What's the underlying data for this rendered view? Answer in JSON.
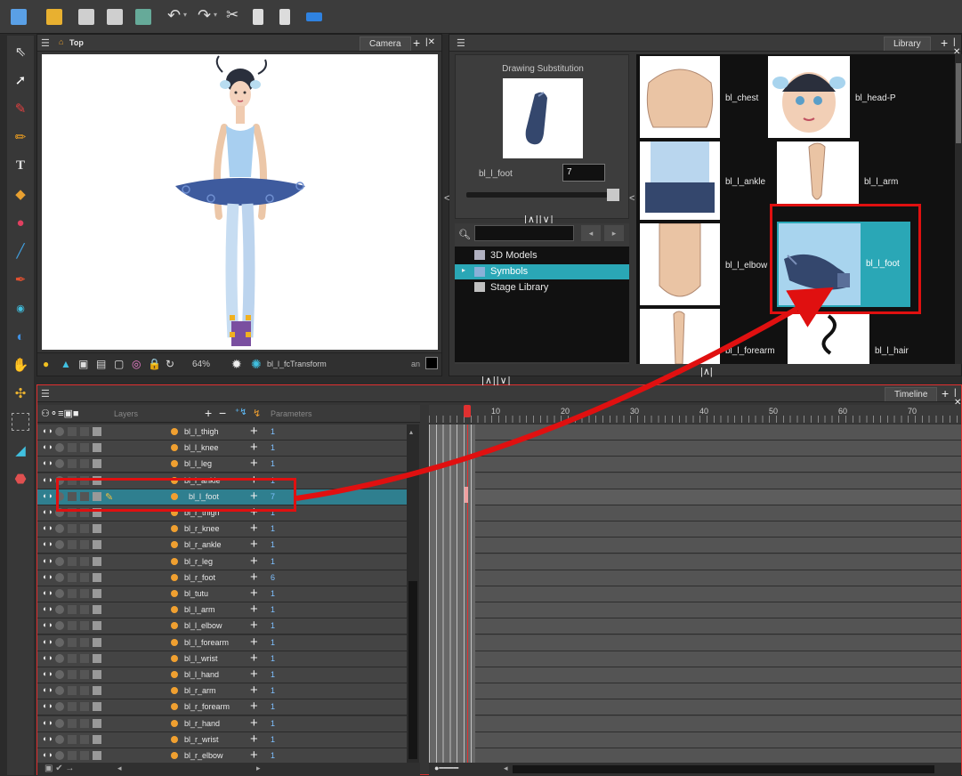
{
  "camera": {
    "title": "Top",
    "tab": "Camera",
    "zoom": "64%",
    "transform_label": "bl_l_fcTransform",
    "right_label": "an"
  },
  "library": {
    "tab": "Library",
    "substitution_title": "Drawing Substitution",
    "element_name": "bl_l_foot",
    "drawing_value": "7",
    "tree": [
      {
        "label": "3D Models"
      },
      {
        "label": "Symbols"
      },
      {
        "label": "Stage Library"
      }
    ],
    "cells": [
      {
        "label": "bl_chest"
      },
      {
        "label": "bl_head-P"
      },
      {
        "label": "bl_l_ankle"
      },
      {
        "label": "bl_l_arm"
      },
      {
        "label": "bl_l_elbow"
      },
      {
        "label": "bl_l_foot"
      },
      {
        "label": "bl_l_forearm"
      },
      {
        "label": "bl_l_hair"
      }
    ]
  },
  "timeline": {
    "tab": "Timeline",
    "col_layers": "Layers",
    "col_parameters": "Parameters",
    "frame_labels": [
      "10",
      "20",
      "30",
      "40",
      "50",
      "60",
      "70"
    ],
    "layers": [
      {
        "name": "bl_l_thigh",
        "param": "1"
      },
      {
        "name": "bl_l_knee",
        "param": "1"
      },
      {
        "name": "bl_l_leg",
        "param": "1"
      },
      {
        "name": "bl_l_ankle",
        "param": "1"
      },
      {
        "name": "bl_l_foot",
        "param": "7"
      },
      {
        "name": "bl_r_thigh",
        "param": "1"
      },
      {
        "name": "bl_r_knee",
        "param": "1"
      },
      {
        "name": "bl_r_ankle",
        "param": "1"
      },
      {
        "name": "bl_r_leg",
        "param": "1"
      },
      {
        "name": "bl_r_foot",
        "param": "6"
      },
      {
        "name": "bl_tutu",
        "param": "1"
      },
      {
        "name": "bl_l_arm",
        "param": "1"
      },
      {
        "name": "bl_l_elbow",
        "param": "1"
      },
      {
        "name": "bl_l_forearm",
        "param": "1"
      },
      {
        "name": "bl_l_wrist",
        "param": "1"
      },
      {
        "name": "bl_l_hand",
        "param": "1"
      },
      {
        "name": "bl_r_arm",
        "param": "1"
      },
      {
        "name": "bl_r_forearm",
        "param": "1"
      },
      {
        "name": "bl_r_hand",
        "param": "1"
      },
      {
        "name": "bl_r_wrist",
        "param": "1"
      },
      {
        "name": "bl_r_elbow",
        "param": "1"
      }
    ]
  },
  "colors": {
    "accent": "#2aa7b6",
    "highlight": "#e01010",
    "selection": "#3a8fa0"
  }
}
